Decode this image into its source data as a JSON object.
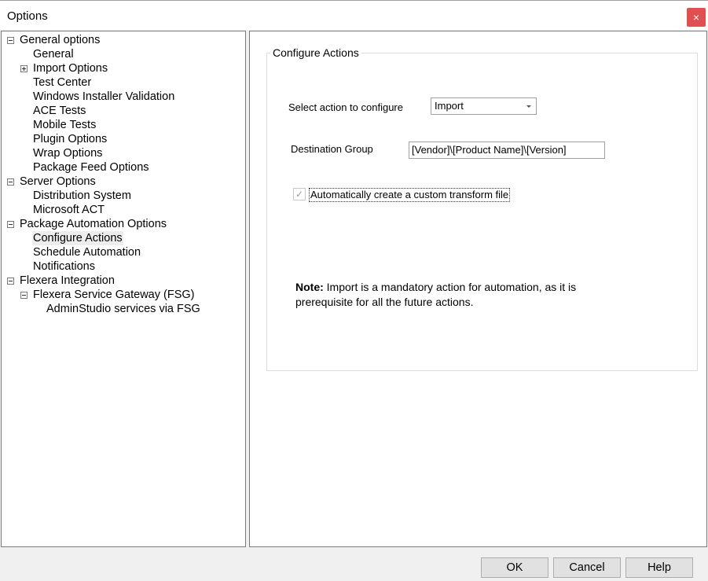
{
  "window": {
    "title": "Options",
    "close_glyph": "×"
  },
  "tree": {
    "items": [
      {
        "label": "General options",
        "level": 0,
        "expander": "minus"
      },
      {
        "label": "General",
        "level": 1
      },
      {
        "label": "Import Options",
        "level": 1,
        "expander": "plus"
      },
      {
        "label": "Test Center",
        "level": 1
      },
      {
        "label": "Windows Installer Validation",
        "level": 1
      },
      {
        "label": "ACE Tests",
        "level": 1
      },
      {
        "label": "Mobile Tests",
        "level": 1
      },
      {
        "label": "Plugin Options",
        "level": 1
      },
      {
        "label": "Wrap Options",
        "level": 1
      },
      {
        "label": "Package Feed Options",
        "level": 1
      },
      {
        "label": "Server Options",
        "level": 0,
        "expander": "minus"
      },
      {
        "label": "Distribution System",
        "level": 1
      },
      {
        "label": "Microsoft ACT",
        "level": 1
      },
      {
        "label": "Package Automation Options",
        "level": 0,
        "expander": "minus"
      },
      {
        "label": "Configure Actions",
        "level": 1,
        "selected": true
      },
      {
        "label": "Schedule Automation",
        "level": 1
      },
      {
        "label": "Notifications",
        "level": 1
      },
      {
        "label": "Flexera Integration",
        "level": 0,
        "expander": "minus"
      },
      {
        "label": "Flexera Service Gateway (FSG)",
        "level": 1,
        "expander": "minus"
      },
      {
        "label": "AdminStudio services via FSG",
        "level": 2
      }
    ]
  },
  "configure": {
    "group_title": "Configure Actions",
    "select_action_label": "Select action to configure",
    "select_action_value": "Import",
    "destination_label": "Destination Group",
    "destination_value": "[Vendor]\\[Product Name]\\[Version]",
    "checkbox_label": "Automatically create a custom transform file",
    "checkbox_checked": true,
    "check_glyph": "✓",
    "note_bold": "Note:",
    "note_text": " Import is a mandatory action for automation, as it is prerequisite for all the future actions."
  },
  "buttons": {
    "ok": "OK",
    "cancel": "Cancel",
    "help": "Help"
  }
}
